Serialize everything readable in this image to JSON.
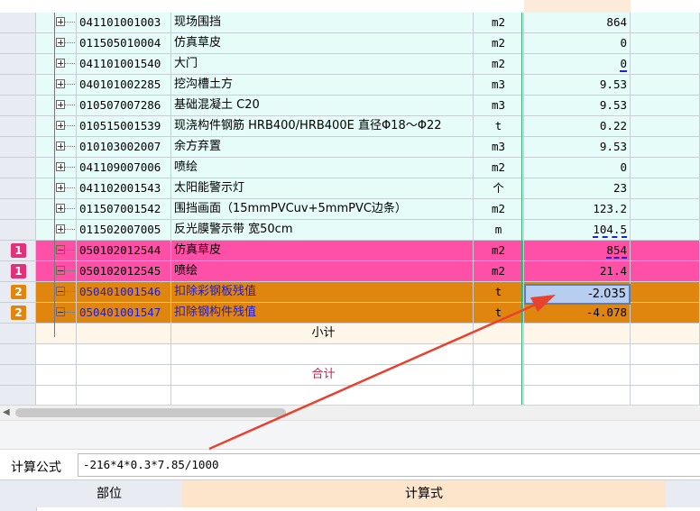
{
  "rows": [
    {
      "code": "041101001003",
      "name": "现场围挡",
      "unit": "m2",
      "value": "864",
      "style": "cyan",
      "tree": "plus"
    },
    {
      "code": "011505010004",
      "name": "仿真草皮",
      "unit": "m2",
      "value": "0",
      "style": "cyan",
      "tree": "plus"
    },
    {
      "code": "041101001540",
      "name": "大门",
      "unit": "m2",
      "value": "0",
      "style": "cyan",
      "tree": "plus",
      "underline": true
    },
    {
      "code": "040101002285",
      "name": "挖沟槽土方",
      "unit": "m3",
      "value": "9.53",
      "style": "cyan",
      "tree": "plus"
    },
    {
      "code": "010507007286",
      "name": "基础混凝土 C20",
      "unit": "m3",
      "value": "9.53",
      "style": "cyan",
      "tree": "plus"
    },
    {
      "code": "010515001539",
      "name": "现浇构件钢筋 HRB400/HRB400E 直径Φ18～Φ22",
      "unit": "t",
      "value": "0.22",
      "style": "cyan",
      "tree": "plus"
    },
    {
      "code": "010103002007",
      "name": "余方弃置",
      "unit": "m3",
      "value": "9.53",
      "style": "cyan",
      "tree": "plus"
    },
    {
      "code": "041109007006",
      "name": "喷绘",
      "unit": "m2",
      "value": "0",
      "style": "cyan",
      "tree": "plus"
    },
    {
      "code": "041102001543",
      "name": "太阳能警示灯",
      "unit": "个",
      "value": "23",
      "style": "cyan",
      "tree": "plus"
    },
    {
      "code": "011507001542",
      "name": "围挡画面（15mmPVCuv+5mmPVC边条）",
      "unit": "m2",
      "value": "123.2",
      "style": "cyan",
      "tree": "plus"
    },
    {
      "code": "011502007005",
      "name": "反光膜警示带 宽50cm",
      "unit": "m",
      "value": "104.5",
      "style": "cyan",
      "tree": "plus",
      "underline": true
    },
    {
      "badge": "1",
      "code": "050102012544",
      "name": "仿真草皮",
      "unit": "m2",
      "value": "854",
      "style": "pink",
      "tree": "minus",
      "underline": true
    },
    {
      "badge": "1",
      "code": "050102012545",
      "name": "喷绘",
      "unit": "m2",
      "value": "21.4",
      "style": "pink",
      "tree": "minus"
    },
    {
      "badge": "2",
      "code": "050401001546",
      "name": "扣除彩钢板残值",
      "unit": "t",
      "value": "-2.035",
      "style": "orange",
      "tree": "minus",
      "selected": true
    },
    {
      "badge": "2",
      "code": "050401001547",
      "name": "扣除钢构件残值",
      "unit": "t",
      "value": "-4.078",
      "style": "orange",
      "tree": "minus"
    }
  ],
  "subtotal_label": "小计",
  "total_label": "合计",
  "formula": {
    "label": "计算公式",
    "value": "-216*4*0.3*7.85/1000"
  },
  "detail_grid": {
    "position_header": "部位",
    "expression_header": "计算式"
  },
  "colors": {
    "cyan_row": "#e6fcf9",
    "pink_row": "#fe50a6",
    "orange_row": "#e0860f",
    "badge1": "#e2307a",
    "badge2": "#e0860f",
    "arrow": "#e8412f"
  }
}
